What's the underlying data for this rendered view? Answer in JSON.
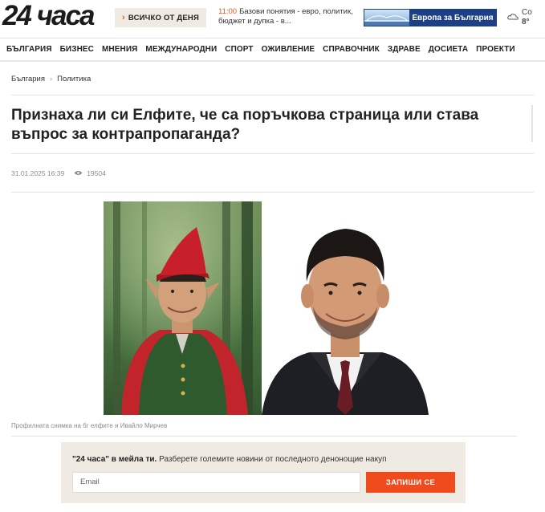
{
  "header": {
    "logo": "24 часа",
    "everything_button": "ВСИЧКО ОТ ДЕНЯ",
    "ticker": {
      "time": "11:00",
      "text": "Базови понятия - евро, политик, бюджет и дупка - в..."
    },
    "banner": "Европа за България",
    "weather": {
      "city": "Co",
      "temp": "8°"
    }
  },
  "nav": [
    "БЪЛГАРИЯ",
    "БИЗНЕС",
    "МНЕНИЯ",
    "МЕЖДУНАРОДНИ",
    "СПОРТ",
    "ОЖИВЛЕНИЕ",
    "СПРАВОЧНИК",
    "ЗДРАВЕ",
    "ДОСИЕТА",
    "ПРОЕКТИ"
  ],
  "breadcrumb": [
    "България",
    "Политика"
  ],
  "article": {
    "title": "Признаха ли си Елфите, че са поръчкова страница или става въпрос за контрапропаганда?",
    "date": "31.01.2025 16:39",
    "views": "19504",
    "caption": "Профилната снимка на бг елфите и Ивайло Мирчев"
  },
  "newsletter": {
    "bold": "\"24 часа\" в мейла ти.",
    "text": " Разберете големите новини от последното денонощие накуп",
    "placeholder": "Email",
    "button": "ЗАПИШИ СЕ"
  },
  "colors": {
    "accent": "#ef4b1c",
    "banner": "#1d3f86",
    "beige": "#efeae2"
  }
}
